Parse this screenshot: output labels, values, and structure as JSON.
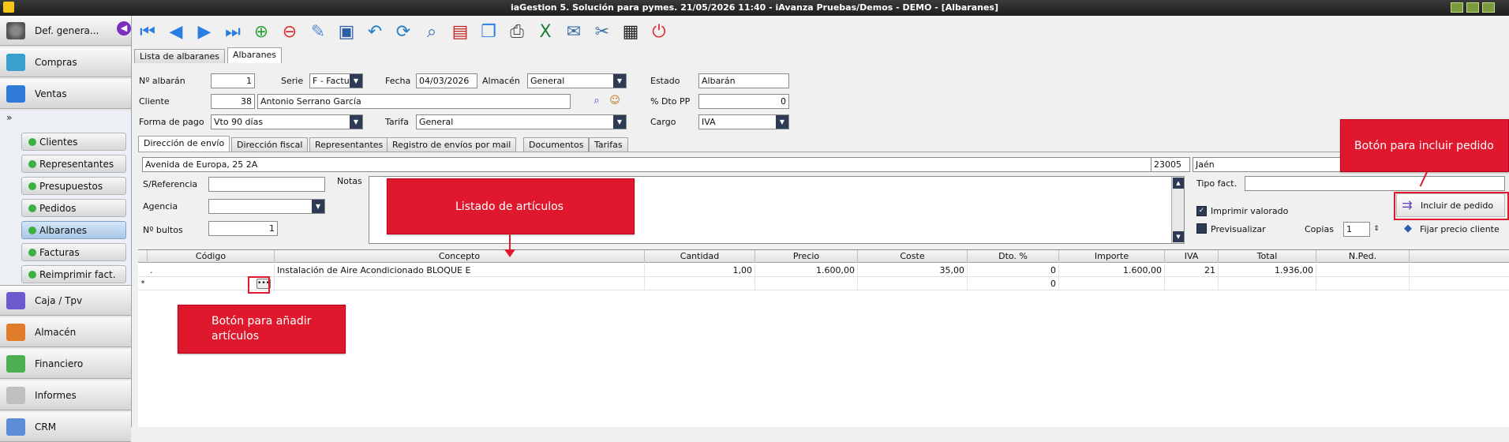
{
  "window": {
    "title": "iaGestion 5. Solución para pymes.  21/05/2026 11:40   -  iAvanza Pruebas/Demos - DEMO - [Albaranes]"
  },
  "sidebar": {
    "top_item": "Def. genera...",
    "items": [
      {
        "label": "Compras"
      },
      {
        "label": "Ventas"
      }
    ],
    "sub_items": [
      {
        "label": "Clientes"
      },
      {
        "label": "Representantes"
      },
      {
        "label": "Presupuestos"
      },
      {
        "label": "Pedidos"
      },
      {
        "label": "Albaranes"
      },
      {
        "label": "Facturas"
      },
      {
        "label": "Reimprimir fact."
      }
    ],
    "bottom_items": [
      {
        "label": "Caja / Tpv"
      },
      {
        "label": "Almacén"
      },
      {
        "label": "Financiero"
      },
      {
        "label": "Informes"
      },
      {
        "label": "CRM"
      }
    ]
  },
  "main_tabs": [
    {
      "label": "Lista de albaranes"
    },
    {
      "label": "Albaranes"
    }
  ],
  "form": {
    "num_albaran_label": "Nº albarán",
    "num_albaran": "1",
    "serie_label": "Serie",
    "serie": "F  - Factu",
    "fecha_label": "Fecha",
    "fecha": "04/03/2026",
    "almacen_label": "Almacén",
    "almacen": "General",
    "estado_label": "Estado",
    "estado": "Albarán",
    "cliente_label": "Cliente",
    "cliente_num": "38",
    "cliente_nombre": "Antonio Serrano García",
    "dto_pp_label": "% Dto PP",
    "dto_pp": "0",
    "forma_pago_label": "Forma de pago",
    "forma_pago": "Vto 90 días",
    "tarifa_label": "Tarifa",
    "tarifa": "General",
    "cargo_label": "Cargo",
    "cargo": "IVA"
  },
  "sub_tabs": [
    {
      "label": "Dirección de envío"
    },
    {
      "label": "Dirección fiscal"
    },
    {
      "label": "Representantes"
    },
    {
      "label": "Registro de envíos por mail"
    },
    {
      "label": "Documentos"
    },
    {
      "label": "Tarifas"
    }
  ],
  "address": {
    "street": "Avenida de Europa, 25 2A",
    "postal_code": "23005",
    "city": "Jaén",
    "s_referencia_label": "S/Referencia",
    "s_referencia": "",
    "notas_label": "Notas",
    "agencia_label": "Agencia",
    "agencia": "",
    "num_bultos_label": "Nº bultos",
    "num_bultos": "1",
    "tipo_fact_label": "Tipo fact.",
    "tipo_fact": "",
    "imprimir_valorado_label": "Imprimir valorado",
    "previsualizar_label": "Previsualizar",
    "copias_label": "Copias",
    "copias": "1",
    "incluir_pedido_label": "Incluir de pedido",
    "fijar_precio_label": "Fijar precio cliente"
  },
  "grid": {
    "columns": [
      "Código",
      "Concepto",
      "Cantidad",
      "Precio",
      "Coste",
      "Dto. %",
      "Importe",
      "IVA",
      "Total",
      "N.Ped."
    ],
    "rows": [
      {
        "codigo": ".",
        "concepto": "Instalación de Aire Acondicionado BLOQUE E",
        "cantidad": "1,00",
        "precio": "1.600,00",
        "coste": "35,00",
        "dto": "0",
        "importe": "1.600,00",
        "iva": "21",
        "total": "1.936,00",
        "nped": ""
      }
    ],
    "new_row": {
      "indicator": "*",
      "dto": "0"
    }
  },
  "callouts": {
    "listado": "Listado de artículos",
    "incluir": "Botón para incluir pedido",
    "anadir_l1": "Botón para añadir",
    "anadir_l2": "artículos"
  },
  "colors": {
    "accent_red": "#e0182d",
    "combo_dark": "#2e3b55",
    "active_green": "#3cb043"
  }
}
